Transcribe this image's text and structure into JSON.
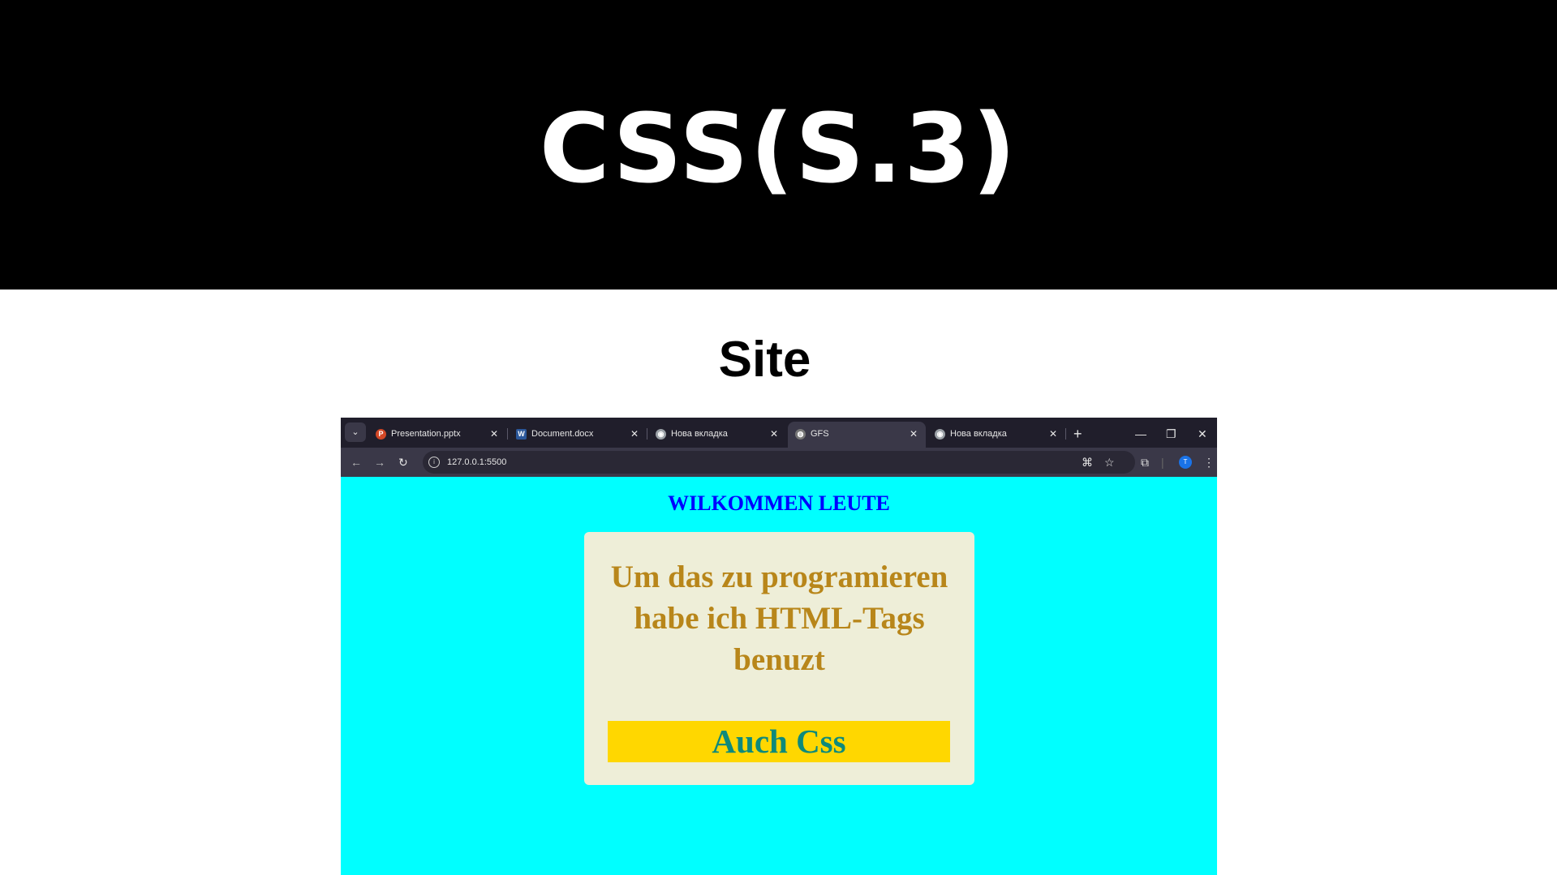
{
  "slide": {
    "title": "CSS(S.3)",
    "subtitle": "Site"
  },
  "browser": {
    "tabs": [
      {
        "label": "Presentation.pptx",
        "icon": "powerpoint-icon",
        "active": false
      },
      {
        "label": "Document.docx",
        "icon": "word-icon",
        "active": false
      },
      {
        "label": "Нова вкладка",
        "icon": "chrome-icon",
        "active": false
      },
      {
        "label": "GFS",
        "icon": "globe-icon",
        "active": true
      },
      {
        "label": "Нова вкладка",
        "icon": "chrome-icon",
        "active": false
      }
    ],
    "address": "127.0.0.1:5500",
    "profile_initial": "T"
  },
  "page": {
    "heading": "WILKOMMEN LEUTE",
    "card_text": "Um das zu programieren habe ich HTML-Tags benuzt",
    "highlight_text": "Auch Css"
  },
  "colors": {
    "page_background": "#00ffff",
    "heading": "#0000ff",
    "card_background": "#eeeed8",
    "card_text": "#b8861a",
    "highlight_background": "#ffd700",
    "highlight_text": "#0e8a7b"
  }
}
